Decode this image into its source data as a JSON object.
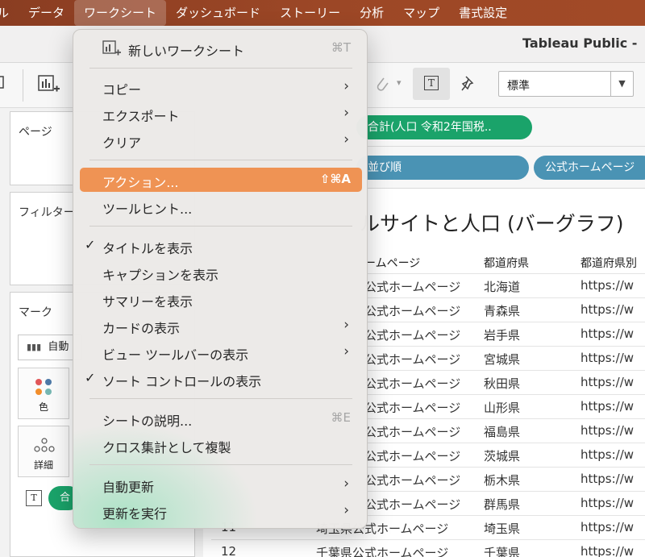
{
  "menubar": {
    "items": [
      "ル",
      "データ",
      "ワークシート",
      "ダッシュボード",
      "ストーリー",
      "分析",
      "マップ",
      "書式設定"
    ],
    "active_index": 2
  },
  "window": {
    "title": "Tableau Public -"
  },
  "toolbar": {
    "zoom_value": "標準",
    "text_button_icon": "T"
  },
  "left": {
    "pages_title": "ページ",
    "filters_title": "フィルター",
    "marks_title": "マーク",
    "mark_type": "自動",
    "color_label": "色",
    "detail_label": "詳細",
    "text_icon": "T",
    "pill_label": "合"
  },
  "shelves": {
    "rows_pill": "合計(人口 令和2年国税..",
    "cols_pill_1": "並び順",
    "cols_pill_2": "公式ホームページ"
  },
  "sheet": {
    "title": "ルサイトと人口 (バーグラフ)",
    "headers": [
      "ームページ",
      "都道府県",
      "都道府県別"
    ],
    "rows": [
      {
        "num": "",
        "page": "公式ホームページ",
        "pref": "北海道",
        "url": "https://w"
      },
      {
        "num": "",
        "page": "公式ホームページ",
        "pref": "青森県",
        "url": "https://w"
      },
      {
        "num": "",
        "page": "公式ホームページ",
        "pref": "岩手県",
        "url": "https://w"
      },
      {
        "num": "",
        "page": "公式ホームページ",
        "pref": "宮城県",
        "url": "https://w"
      },
      {
        "num": "",
        "page": "公式ホームページ",
        "pref": "秋田県",
        "url": "https://w"
      },
      {
        "num": "",
        "page": "公式ホームページ",
        "pref": "山形県",
        "url": "https://w"
      },
      {
        "num": "",
        "page": "公式ホームページ",
        "pref": "福島県",
        "url": "https://w"
      },
      {
        "num": "",
        "page": "公式ホームページ",
        "pref": "茨城県",
        "url": "https://w"
      },
      {
        "num": "",
        "page": "公式ホームページ",
        "pref": "栃木県",
        "url": "https://w"
      },
      {
        "num": "",
        "page": "公式ホームページ",
        "pref": "群馬県",
        "url": "https://w"
      },
      {
        "num": "11",
        "page": "埼玉県公式ホームページ",
        "pref": "埼玉県",
        "url": "https://w"
      },
      {
        "num": "12",
        "page": "千葉県公式ホームページ",
        "pref": "千葉県",
        "url": "https://w"
      }
    ]
  },
  "menu": {
    "new_worksheet": {
      "label": "新しいワークシート",
      "shortcut": "⌘T"
    },
    "copy": "コピー",
    "export": "エクスポート",
    "clear": "クリア",
    "actions": {
      "label": "アクション...",
      "shortcut": "⇧⌘A"
    },
    "tooltip": "ツールヒント...",
    "show_title": "タイトルを表示",
    "show_caption": "キャプションを表示",
    "show_summary": "サマリーを表示",
    "show_cards": "カードの表示",
    "show_view_toolbar": "ビュー ツールバーの表示",
    "show_sort_controls": "ソート コントロールの表示",
    "describe_sheet": {
      "label": "シートの説明...",
      "shortcut": "⌘E"
    },
    "duplicate_crosstab": "クロス集計として複製",
    "auto_update": "自動更新",
    "run_update": "更新を実行",
    "checkmark": "✓",
    "chevron": "›"
  }
}
